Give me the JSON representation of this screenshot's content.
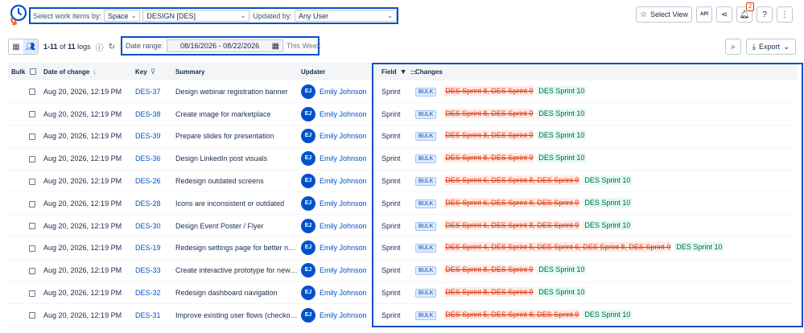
{
  "filters": {
    "work_items_label": "Select work items by:",
    "space_value": "Space",
    "project_value": "DESIGN [DES]",
    "updated_by_label": "Updated by:",
    "updated_by_value": "Any User"
  },
  "header_actions": {
    "select_view_label": "Select View",
    "api_label": "API",
    "notification_count": "2"
  },
  "toolbar": {
    "range_start": "1-11",
    "of_text": "of",
    "total": "11",
    "logs_text": "logs",
    "date_range_label": "Date range:",
    "date_range_value": "08/16/2026 - 08/22/2026",
    "date_preset": "This Week",
    "export_label": "Export"
  },
  "table": {
    "columns": [
      "Bulk",
      "Date of change",
      "Key",
      "Summary",
      "Updater",
      "Field",
      "Changes"
    ],
    "bulk_tag": "BULK",
    "rows": [
      {
        "date": "Aug 20, 2026, 12:19 PM",
        "key": "DES-37",
        "summary": "Design webinar registration banner",
        "initials": "EJ",
        "updater": "Emily Johnson",
        "field": "Sprint",
        "old": "DES Sprint 8, DES Sprint 9",
        "new": "DES Sprint 10"
      },
      {
        "date": "Aug 20, 2026, 12:19 PM",
        "key": "DES-38",
        "summary": "Create image for marketplace",
        "initials": "EJ",
        "updater": "Emily Johnson",
        "field": "Sprint",
        "old": "DES Sprint 8, DES Sprint 9",
        "new": "DES Sprint 10"
      },
      {
        "date": "Aug 20, 2026, 12:19 PM",
        "key": "DES-39",
        "summary": "Prepare slides for presentation",
        "initials": "EJ",
        "updater": "Emily Johnson",
        "field": "Sprint",
        "old": "DES Sprint 8, DES Sprint 9",
        "new": "DES Sprint 10"
      },
      {
        "date": "Aug 20, 2026, 12:19 PM",
        "key": "DES-36",
        "summary": "Design LinkedIn post visuals",
        "initials": "EJ",
        "updater": "Emily Johnson",
        "field": "Sprint",
        "old": "DES Sprint 8, DES Sprint 9",
        "new": "DES Sprint 10"
      },
      {
        "date": "Aug 20, 2026, 12:19 PM",
        "key": "DES-26",
        "summary": "Redesign outdated screens",
        "initials": "EJ",
        "updater": "Emily Johnson",
        "field": "Sprint",
        "old": "DES Sprint 6, DES Sprint 8, DES Sprint 9",
        "new": "DES Sprint 10"
      },
      {
        "date": "Aug 20, 2026, 12:19 PM",
        "key": "DES-28",
        "summary": "Icons are inconsistent or outdated",
        "initials": "EJ",
        "updater": "Emily Johnson",
        "field": "Sprint",
        "old": "DES Sprint 6, DES Sprint 8, DES Sprint 9",
        "new": "DES Sprint 10"
      },
      {
        "date": "Aug 20, 2026, 12:19 PM",
        "key": "DES-30",
        "summary": "Design Event Poster / Flyer",
        "initials": "EJ",
        "updater": "Emily Johnson",
        "field": "Sprint",
        "old": "DES Sprint 6, DES Sprint 8, DES Sprint 9",
        "new": "DES Sprint 10"
      },
      {
        "date": "Aug 20, 2026, 12:19 PM",
        "key": "DES-19",
        "summary": "Redesign settings page for better nav...",
        "initials": "EJ",
        "updater": "Emily Johnson",
        "field": "Sprint",
        "old": "DES Sprint 4, DES Sprint 5, DES Sprint 6, DES Sprint 8, DES Sprint 9",
        "new": "DES Sprint 10"
      },
      {
        "date": "Aug 20, 2026, 12:19 PM",
        "key": "DES-33",
        "summary": "Create interactive prototype for new f...",
        "initials": "EJ",
        "updater": "Emily Johnson",
        "field": "Sprint",
        "old": "DES Sprint 8, DES Sprint 9",
        "new": "DES Sprint 10"
      },
      {
        "date": "Aug 20, 2026, 12:19 PM",
        "key": "DES-32",
        "summary": "Redesign dashboard navigation",
        "initials": "EJ",
        "updater": "Emily Johnson",
        "field": "Sprint",
        "old": "DES Sprint 8, DES Sprint 9",
        "new": "DES Sprint 10"
      },
      {
        "date": "Aug 20, 2026, 12:19 PM",
        "key": "DES-31",
        "summary": "Improve existing user flows (checkou...",
        "initials": "EJ",
        "updater": "Emily Johnson",
        "field": "Sprint",
        "old": "DES Sprint 5, DES Sprint 8, DES Sprint 9",
        "new": "DES Sprint 10"
      }
    ]
  }
}
